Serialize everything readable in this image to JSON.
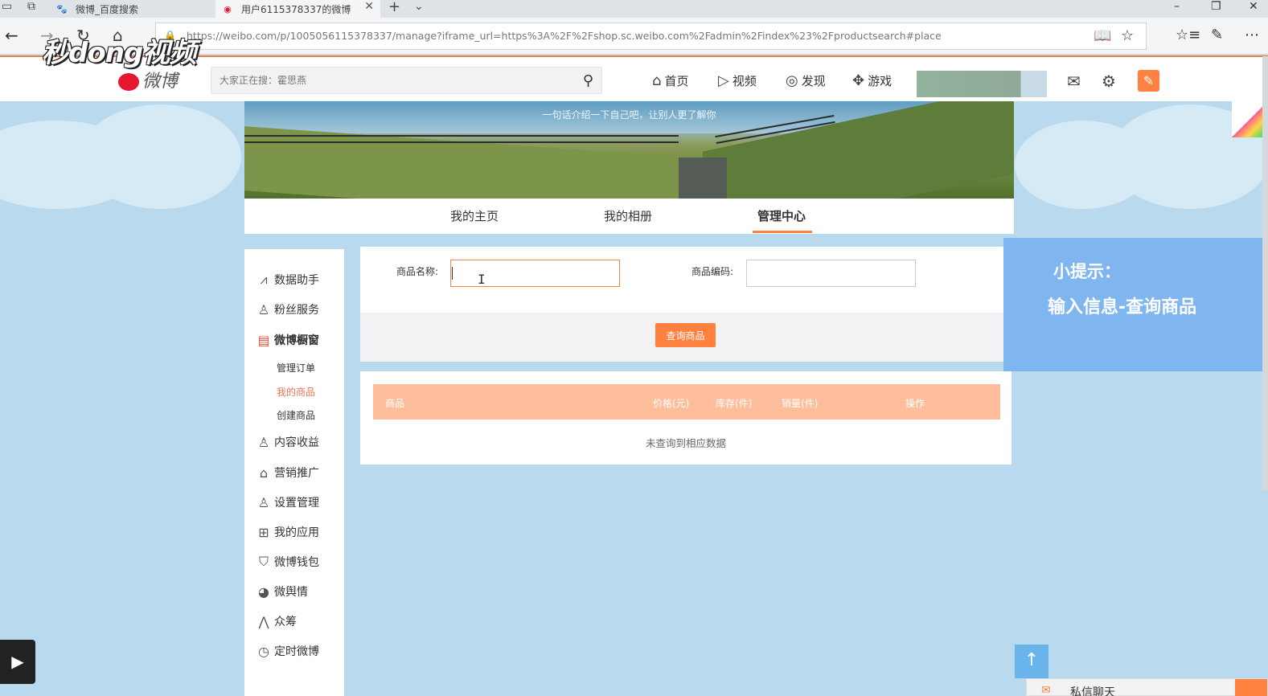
{
  "browser": {
    "tabs": [
      {
        "title": "微博_百度搜索",
        "active": false
      },
      {
        "title": "用户6115378337的微博",
        "active": true
      }
    ],
    "url": "https://weibo.com/p/1005056115378337/manage?iframe_url=https%3A%2F%2Fshop.sc.weibo.com%2Fadmin%2Findex%23%2Fproductsearch#place"
  },
  "watermark": "秒dong视频",
  "header": {
    "logo_text": "微博",
    "search_placeholder": "大家正在搜：霍思燕",
    "nav": [
      {
        "label": "首页",
        "icon": "home-icon"
      },
      {
        "label": "视频",
        "icon": "video-icon"
      },
      {
        "label": "发现",
        "icon": "compass-icon"
      },
      {
        "label": "游戏",
        "icon": "gamepad-icon"
      }
    ]
  },
  "cover": {
    "intro": "一句话介绍一下自己吧，让别人更了解你"
  },
  "profile_tabs": [
    {
      "label": "我的主页",
      "active": false
    },
    {
      "label": "我的相册",
      "active": false
    },
    {
      "label": "管理中心",
      "active": true
    }
  ],
  "sidebar": {
    "items": [
      {
        "label": "数据助手",
        "icon": "chart-icon"
      },
      {
        "label": "粉丝服务",
        "icon": "fans-icon"
      },
      {
        "label": "微博橱窗",
        "icon": "shop-icon",
        "active": true
      },
      {
        "label": "内容收益",
        "icon": "income-icon"
      },
      {
        "label": "营销推广",
        "icon": "bag-icon"
      },
      {
        "label": "设置管理",
        "icon": "user-gear-icon"
      },
      {
        "label": "我的应用",
        "icon": "apps-icon"
      },
      {
        "label": "微博钱包",
        "icon": "wallet-icon"
      },
      {
        "label": "微舆情",
        "icon": "opinion-icon"
      },
      {
        "label": "众筹",
        "icon": "crowdfund-icon"
      },
      {
        "label": "定时微博",
        "icon": "timer-icon"
      }
    ],
    "sub_items": [
      {
        "label": "管理订单",
        "active": false
      },
      {
        "label": "我的商品",
        "active": true
      },
      {
        "label": "创建商品",
        "active": false
      }
    ]
  },
  "form": {
    "name_label": "商品名称:",
    "name_value": "",
    "code_label": "商品编码:",
    "code_value": "",
    "query_button": "查询商品"
  },
  "table": {
    "columns": [
      "商品",
      "价格(元)",
      "库存(件)",
      "销量(件)",
      "操作"
    ],
    "empty_message": "未查询到相应数据"
  },
  "tip": {
    "title": "小提示：",
    "text": "输入信息-查询商品"
  },
  "chat": {
    "label": "私信聊天"
  },
  "colors": {
    "accent": "#ff8140",
    "table_header": "#ffbe9b",
    "tip_bg": "#7fb6f0"
  }
}
